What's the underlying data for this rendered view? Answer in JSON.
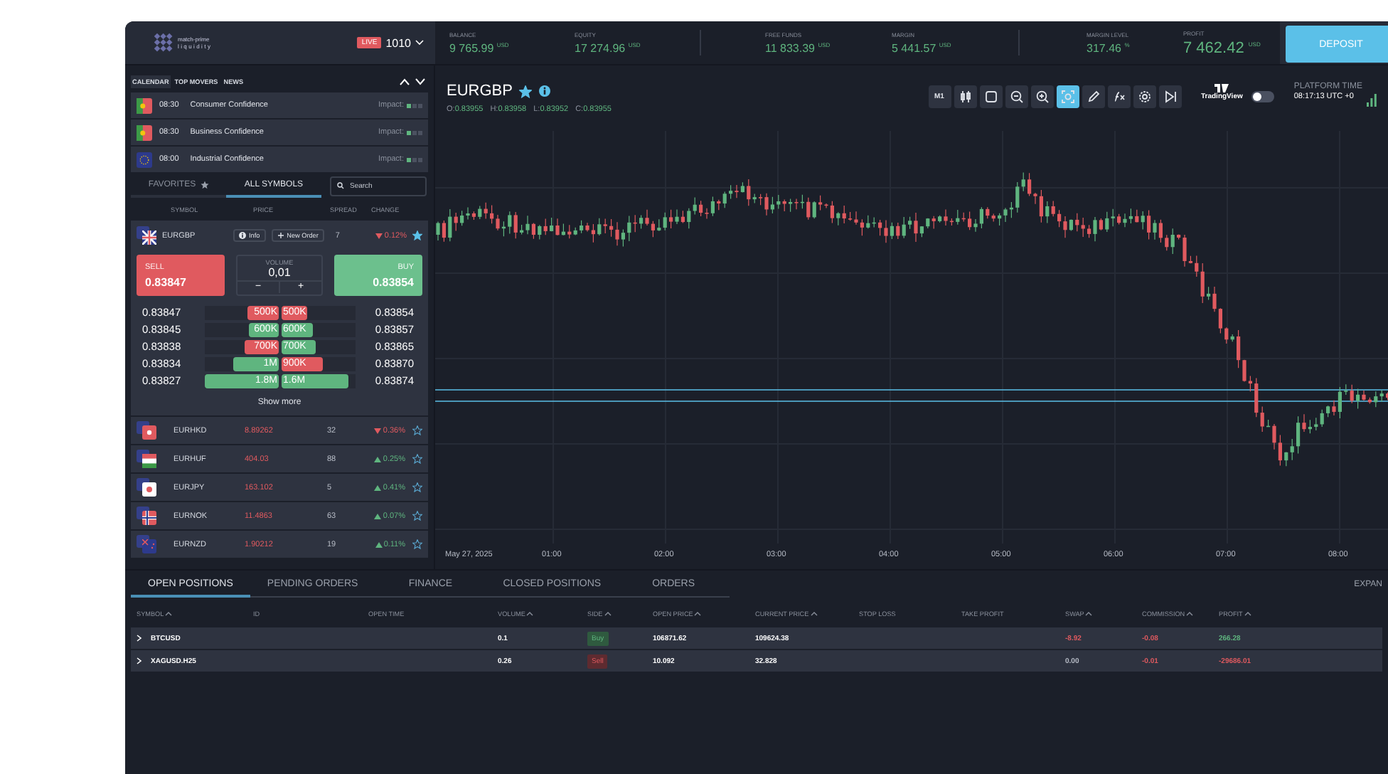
{
  "brand": {
    "name": "match-prime",
    "tagline": "liquidity"
  },
  "account": {
    "badge": "LIVE",
    "number": "1010"
  },
  "stat_groups": [
    [
      {
        "label": "BALANCE",
        "value": "9 765.99",
        "unit": "USD",
        "kind": "normal"
      },
      {
        "label": "EQUITY",
        "value": "17 274.96",
        "unit": "USD",
        "kind": "normal"
      }
    ],
    [
      {
        "label": "FREE FUNDS",
        "value": "11 833.39",
        "unit": "USD",
        "kind": "normal"
      },
      {
        "label": "MARGIN",
        "value": "5 441.57",
        "unit": "USD",
        "kind": "normal"
      }
    ],
    [
      {
        "label": "MARGIN LEVEL",
        "value": "317.46",
        "unit": "%",
        "kind": "normal"
      },
      {
        "label": "PROFIT",
        "value": "7 462.42",
        "unit": "USD",
        "kind": "large"
      }
    ]
  ],
  "deposit_button": "DEPOSIT",
  "news_tabs": [
    {
      "label": "CALENDAR",
      "selected": true
    },
    {
      "label": "TOP MOVERS",
      "selected": false
    },
    {
      "label": "NEWS",
      "selected": false
    }
  ],
  "calendar": [
    {
      "kind": "pt",
      "time": "08:30",
      "title": "Consumer Confidence",
      "impact_label": "Impact:",
      "stars": 1
    },
    {
      "kind": "pt",
      "time": "08:30",
      "title": "Business Confidence",
      "impact_label": "Impact:",
      "stars": 1
    },
    {
      "kind": "eu",
      "time": "08:00",
      "title": "Industrial Confidence",
      "impact_label": "Impact:",
      "stars": 1
    }
  ],
  "symbol_tabs": [
    {
      "label": "FAVORITES",
      "selected": false
    },
    {
      "label": "ALL SYMBOLS",
      "selected": true
    }
  ],
  "search": {
    "placeholder": "Search"
  },
  "columns": [
    "SYMBOL",
    "PRICE",
    "SPREAD",
    "CHANGE"
  ],
  "expanded": {
    "kind": "gb",
    "symbol": "EURGBP",
    "info": "Info",
    "new_order": "New Order",
    "spread": "7",
    "change": "0.12%",
    "rising": false,
    "favorite": true,
    "sell": {
      "label": "SELL",
      "price": "0.83847"
    },
    "volume": {
      "label": "VOLUME",
      "value": "0,01",
      "minus": "−",
      "plus": "+"
    },
    "buy": {
      "label": "BUY",
      "price": "0.83854"
    },
    "depth": [
      {
        "bid": {
          "price": "0.83847",
          "size": "500K",
          "level": 0.43,
          "color": "#e05a5f"
        },
        "ask": {
          "size": "500K",
          "level": 0.35,
          "color": "#e05a5f",
          "price": "0.83854"
        }
      },
      {
        "bid": {
          "price": "0.83845",
          "size": "600K",
          "level": 0.4,
          "color": "#5fb57f"
        },
        "ask": {
          "size": "600K",
          "level": 0.42,
          "color": "#5fb57f",
          "price": "0.83857"
        }
      },
      {
        "bid": {
          "price": "0.83838",
          "size": "700K",
          "level": 0.46,
          "color": "#e05a5f"
        },
        "ask": {
          "size": "700K",
          "level": 0.46,
          "color": "#5fb57f",
          "price": "0.83865"
        }
      },
      {
        "bid": {
          "price": "0.83834",
          "size": "1M",
          "level": 0.61,
          "color": "#5fb57f"
        },
        "ask": {
          "size": "900K",
          "level": 0.55,
          "color": "#e05a5f",
          "price": "0.83870"
        }
      },
      {
        "bid": {
          "price": "0.83827",
          "size": "1.8M",
          "level": 1,
          "color": "#5fb57f"
        },
        "ask": {
          "size": "1.6M",
          "level": 0.9,
          "color": "#5fb57f",
          "price": "0.83874"
        }
      }
    ],
    "show_more": "Show more"
  },
  "symbols": [
    {
      "kind": "hk",
      "symbol": "EURHKD",
      "price": "8.89262",
      "spread": "32",
      "change": "0.36%",
      "rising": false,
      "favorite": false
    },
    {
      "kind": "hu",
      "symbol": "EURHUF",
      "price": "404.03",
      "spread": "88",
      "change": "0.25%",
      "rising": true,
      "favorite": false
    },
    {
      "kind": "jp",
      "symbol": "EURJPY",
      "price": "163.102",
      "spread": "5",
      "change": "0.41%",
      "rising": true,
      "favorite": false
    },
    {
      "kind": "no",
      "symbol": "EURNOK",
      "price": "11.4863",
      "spread": "63",
      "change": "0.07%",
      "rising": true,
      "favorite": false
    },
    {
      "kind": "nz",
      "symbol": "EURNZD",
      "price": "1.90212",
      "spread": "19",
      "change": "0.11%",
      "rising": true,
      "favorite": false
    }
  ],
  "chart": {
    "symbol": "EURGBP",
    "favorite": true,
    "ohlc": [
      {
        "label": "O:",
        "value": "0.83955"
      },
      {
        "label": "H:",
        "value": "0.83958"
      },
      {
        "label": "L:",
        "value": "0.83952"
      },
      {
        "label": "C:",
        "value": "0.83955"
      }
    ],
    "tools": [
      {
        "kind": "text",
        "label": "M1",
        "selected": false
      },
      {
        "kind": "candles",
        "selected": false
      },
      {
        "kind": "square",
        "selected": false
      },
      {
        "kind": "zoom-out",
        "selected": false
      },
      {
        "kind": "zoom-in",
        "selected": false
      },
      {
        "kind": "fit",
        "selected": true
      },
      {
        "kind": "pencil",
        "selected": false
      },
      {
        "kind": "formula",
        "selected": false
      },
      {
        "kind": "settings",
        "selected": false
      },
      {
        "kind": "skip",
        "selected": false
      }
    ],
    "tradingview": {
      "label": "TradingView",
      "on": false
    },
    "platform_time": {
      "label": "PLATFORM TIME",
      "value": "08:17:13 UTC +0"
    },
    "date_label": "May 27, 2025",
    "x_labels": [
      "01:00",
      "02:00",
      "03:00",
      "04:00",
      "05:00",
      "06:00",
      "07:00",
      "08:00"
    ]
  },
  "bottom_tabs": [
    {
      "label": "OPEN POSITIONS",
      "selected": true
    },
    {
      "label": "PENDING ORDERS",
      "selected": false
    },
    {
      "label": "FINANCE",
      "selected": false
    },
    {
      "label": "CLOSED POSITIONS",
      "selected": false
    },
    {
      "label": "ORDERS",
      "selected": false
    }
  ],
  "expand": "EXPAN",
  "table": {
    "columns": [
      {
        "label": "SYMBOL",
        "sortable": true
      },
      {
        "label": "ID",
        "sortable": false
      },
      {
        "label": "OPEN TIME",
        "sortable": false
      },
      {
        "label": "VOLUME",
        "sortable": true
      },
      {
        "label": "SIDE",
        "sortable": true
      },
      {
        "label": "OPEN PRICE",
        "sortable": true
      },
      {
        "label": "CURRENT PRICE",
        "sortable": true
      },
      {
        "label": "STOP LOSS",
        "sortable": false
      },
      {
        "label": "TAKE PROFIT",
        "sortable": false
      },
      {
        "label": "SWAP",
        "sortable": true
      },
      {
        "label": "COMMISSION",
        "sortable": true
      },
      {
        "label": "PROFIT",
        "sortable": true
      }
    ],
    "rows": [
      {
        "kind": "buy",
        "symbol": "BTCUSD",
        "volume": "0.1",
        "side": "Buy",
        "open_price": "106871.62",
        "current_price": "109624.38",
        "swap": {
          "text": "-8.92",
          "color": "#e05a5f"
        },
        "commission": {
          "text": "-0.08",
          "color": "#e05a5f"
        },
        "profit": {
          "text": "266.28",
          "color": "#5fb57f"
        }
      },
      {
        "kind": "sell",
        "symbol": "XAGUSD.H25",
        "volume": "0.26",
        "side": "Sell",
        "open_price": "10.092",
        "current_price": "32.828",
        "swap": {
          "text": "0.00",
          "color": "#b7bcc6"
        },
        "commission": {
          "text": "-0.01",
          "color": "#e05a5f"
        },
        "profit": {
          "text": "-29686.01",
          "color": "#e05a5f"
        }
      }
    ]
  }
}
